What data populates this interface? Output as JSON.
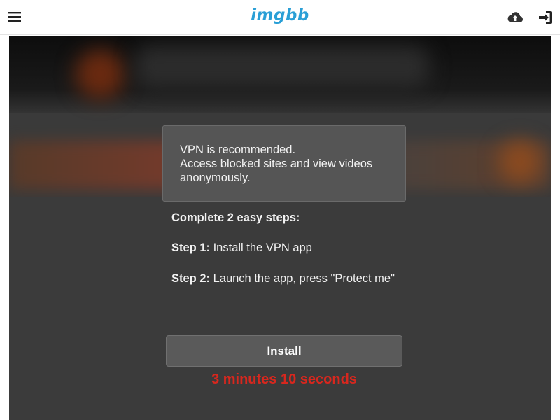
{
  "header": {
    "logo_text": "imgbb",
    "menu_icon": "hamburger-menu-icon",
    "upload_icon": "cloud-upload-icon",
    "signin_icon": "sign-in-icon"
  },
  "notice": {
    "line1": "VPN is recommended.",
    "line2": "Access blocked sites and view videos",
    "line3": "anonymously."
  },
  "steps": {
    "title": "Complete 2 easy steps:",
    "step1_label": "Step 1:",
    "step1_text": " Install the VPN app",
    "step2_label": "Step 2:",
    "step2_text": " Launch the app, press \"Protect me\""
  },
  "install_button": {
    "label": "Install"
  },
  "countdown": {
    "text": "3 minutes 10 seconds"
  },
  "colors": {
    "brand": "#2a9fd6",
    "countdown": "#d8271e"
  }
}
